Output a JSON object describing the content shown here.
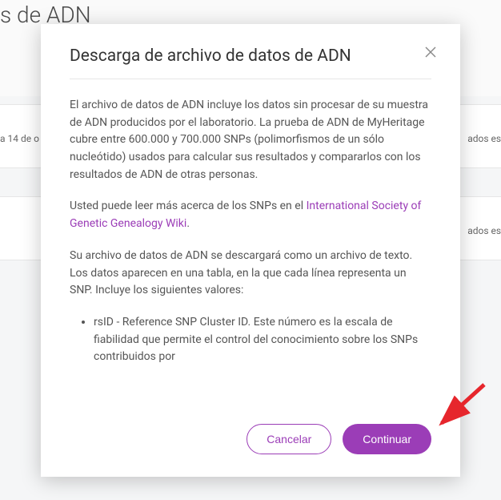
{
  "background": {
    "title_fragment": "s de ADN",
    "row1_left": "a 14 de o",
    "row1_right": "ados est",
    "row2_right": "ados est"
  },
  "modal": {
    "title": "Descarga de archivo de datos de ADN",
    "p1": "El archivo de datos de ADN incluye los datos sin procesar de su muestra de ADN producidos por el laboratorio. La prueba de ADN de MyHeritage cubre entre 600.000 y 700.000 SNPs (polimorfismos de un sólo nucleótido) usados para calcular sus resultados y compararlos con los resultados de ADN de otras personas.",
    "p2_a": "Usted puede leer más acerca de los SNPs en el ",
    "p2_link": "International Society of Genetic Genealogy Wiki",
    "p2_b": ".",
    "p3": "Su archivo de datos de ADN se descargará como un archivo de texto. Los datos aparecen en una tabla, en la que cada línea representa un SNP. Incluye los siguientes valores:",
    "bullets": [
      "rsID - Reference SNP Cluster ID. Este número es la escala de fiabilidad que permite el control del conocimiento sobre los SNPs contribuidos por"
    ],
    "buttons": {
      "cancel": "Cancelar",
      "continue": "Continuar"
    }
  },
  "colors": {
    "accent": "#9b3db7"
  }
}
